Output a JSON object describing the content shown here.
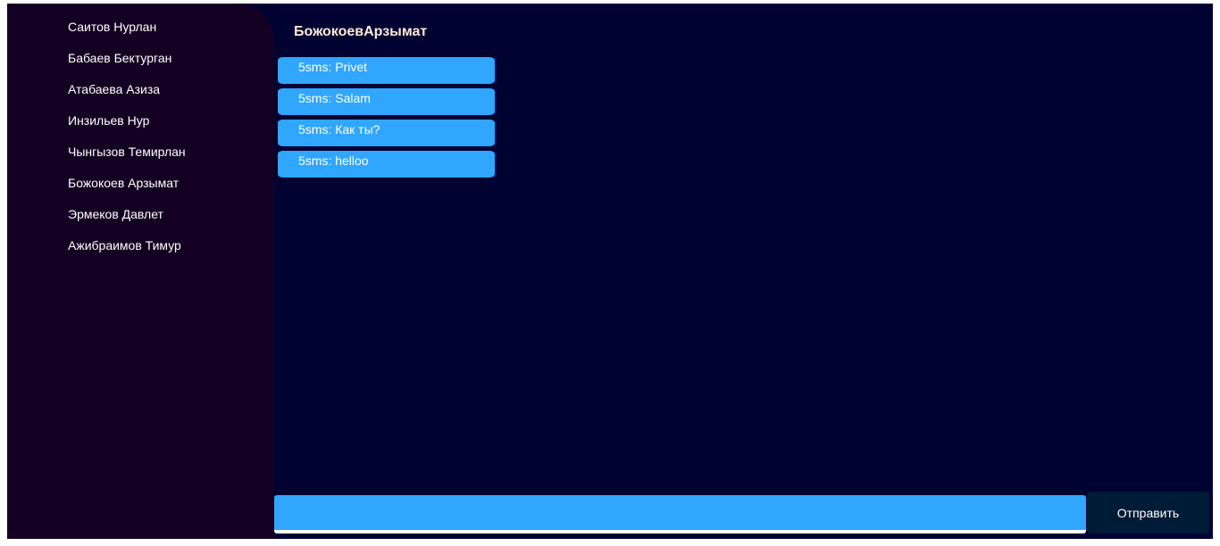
{
  "sidebar": {
    "contacts": [
      "Саитов Нурлан",
      "Бабаев Бектурган",
      "Атабаева Азиза",
      "Инзильев Нур",
      "Чынгызов Темирлан",
      "Божокоев Арзымат",
      "Эрмеков Давлет",
      "Ажибраимов Тимур"
    ]
  },
  "chat": {
    "title": "БожокоевАрзымат",
    "messages": [
      "5sms: Privet",
      "5sms: Salam",
      "5sms: Как ты?",
      "5sms: helloo"
    ]
  },
  "composer": {
    "value": "",
    "send_label": "Отправить"
  },
  "colors": {
    "sidebar": "#140022",
    "main": "#000332",
    "bubble": "#30a6ff",
    "send": "#001b35"
  }
}
